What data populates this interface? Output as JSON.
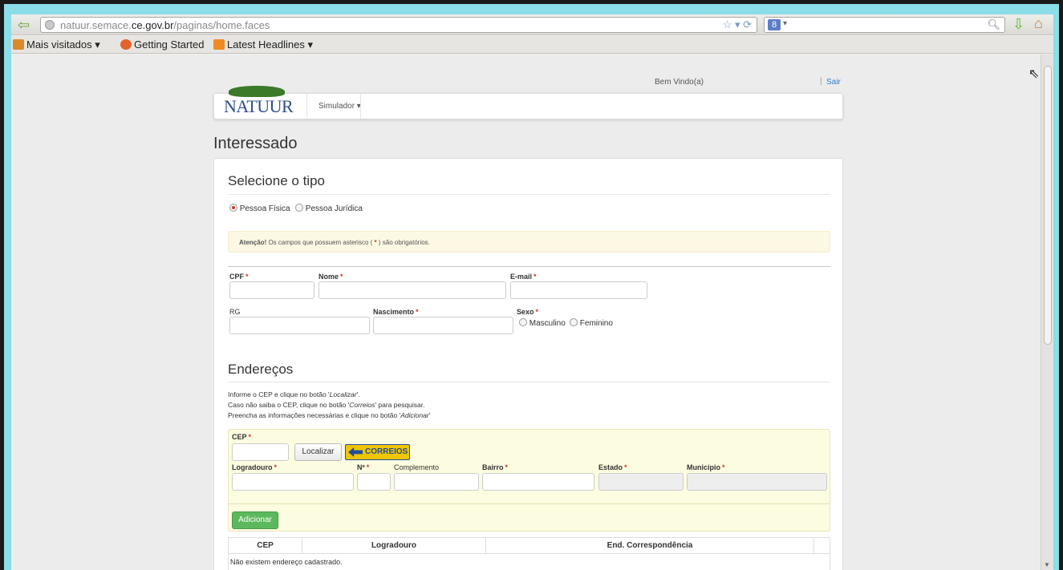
{
  "browser": {
    "url_prefix": "natuur.semace.",
    "url_domain": "ce.gov.br",
    "url_path": "/paginas/home.faces",
    "bookmarks": [
      {
        "label": "Mais visitados ▾",
        "color": "#d98b2b"
      },
      {
        "label": "Getting Started",
        "color": "#e5622a"
      },
      {
        "label": "Latest Headlines ▾",
        "color": "#f08a24"
      }
    ],
    "search_engine_glyph": "8"
  },
  "header": {
    "welcome": "Bem Vindo(a)",
    "logout": "Sair",
    "logo_text": "NATUUR",
    "nav_item": "Simulador ▾"
  },
  "page": {
    "title": "Interessado"
  },
  "type_section": {
    "heading": "Selecione o tipo",
    "options": [
      "Pessoa Física",
      "Pessoa Jurídica"
    ],
    "selected": "Pessoa Física"
  },
  "alert": {
    "strong": "Atenção!",
    "text_before": " Os campos que possuem asterisco ( ",
    "asterisk": "*",
    "text_after": " ) são obrigatórios."
  },
  "person_form": {
    "cpf": "CPF",
    "nome": "Nome",
    "email": "E-mail",
    "rg": "RG",
    "nascimento": "Nascimento",
    "sexo": "Sexo",
    "sexo_options": [
      "Masculino",
      "Feminino"
    ]
  },
  "address_section": {
    "heading": "Endereços",
    "help1_before": "Informe o CEP e clique no botão '",
    "help1_em": "Localizar",
    "help1_after": "'.",
    "help2_before": "Caso não saiba o CEP, clique no botão '",
    "help2_em": "Correios",
    "help2_after": "' para pesquisar.",
    "help3_before": "Preencha as informações necessárias e clique no botão '",
    "help3_em": "Adicionar",
    "help3_after": "'",
    "cep": "CEP",
    "localizar": "Localizar",
    "correios": "CORREIOS",
    "logradouro": "Logradouro",
    "numero": "Nº",
    "complemento": "Complemento",
    "bairro": "Bairro",
    "estado": "Estado",
    "municipio": "Município",
    "adicionar": "Adicionar",
    "required_mark": "*"
  },
  "address_table": {
    "columns": [
      "CEP",
      "Logradouro",
      "End. Correspondência"
    ],
    "empty_message": "Não existem endereço cadastrado."
  }
}
